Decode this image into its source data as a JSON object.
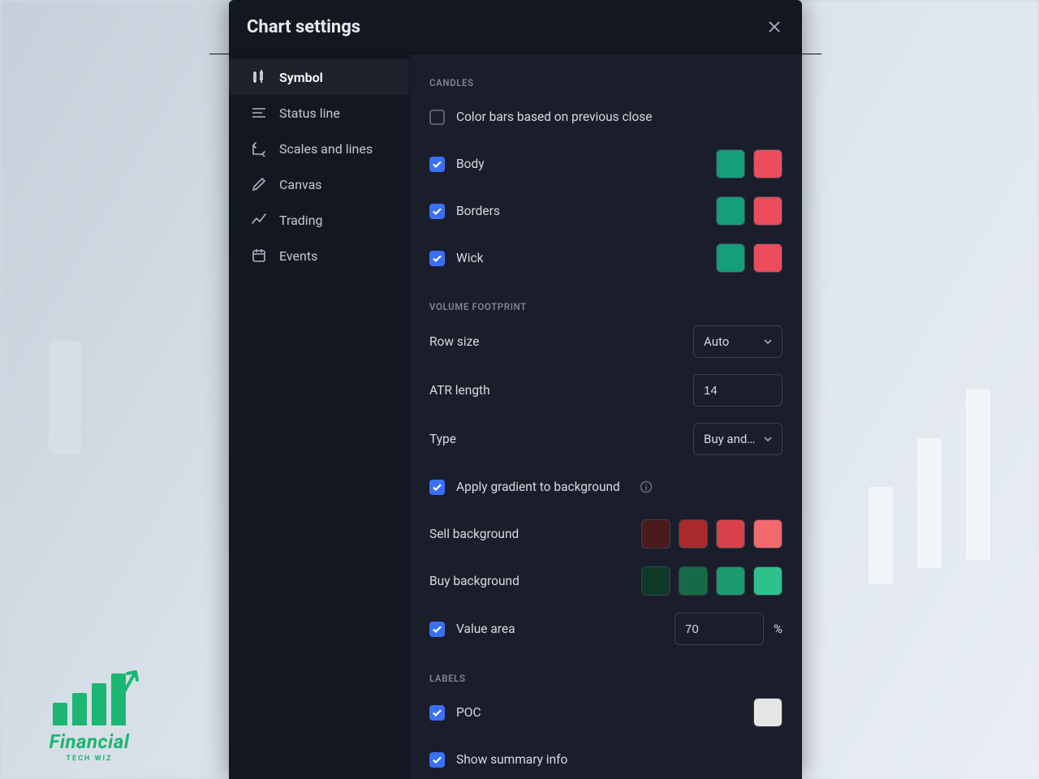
{
  "modal": {
    "title": "Chart settings"
  },
  "sidebar": {
    "items": [
      {
        "label": "Symbol",
        "active": true
      },
      {
        "label": "Status line",
        "active": false
      },
      {
        "label": "Scales and lines",
        "active": false
      },
      {
        "label": "Canvas",
        "active": false
      },
      {
        "label": "Trading",
        "active": false
      },
      {
        "label": "Events",
        "active": false
      }
    ]
  },
  "sections": {
    "candles": {
      "title": "CANDLES",
      "color_bars_prev_close": {
        "label": "Color bars based on previous close",
        "checked": false
      },
      "body": {
        "label": "Body",
        "checked": true,
        "color_up": "#159e7a",
        "color_down": "#eb4d5c"
      },
      "borders": {
        "label": "Borders",
        "checked": true,
        "color_up": "#159e7a",
        "color_down": "#eb4d5c"
      },
      "wick": {
        "label": "Wick",
        "checked": true,
        "color_up": "#159e7a",
        "color_down": "#eb4d5c"
      }
    },
    "volume_footprint": {
      "title": "VOLUME FOOTPRINT",
      "row_size": {
        "label": "Row size",
        "value": "Auto"
      },
      "atr_length": {
        "label": "ATR length",
        "value": "14"
      },
      "type": {
        "label": "Type",
        "value": "Buy and …"
      },
      "apply_gradient": {
        "label": "Apply gradient to background",
        "checked": true
      },
      "sell_bg": {
        "label": "Sell background",
        "colors": [
          "#4a1b1b",
          "#a82a2a",
          "#d84149",
          "#f26a6e"
        ]
      },
      "buy_bg": {
        "label": "Buy background",
        "colors": [
          "#0e3a27",
          "#176a48",
          "#1c9b6e",
          "#2cc18d"
        ]
      },
      "value_area": {
        "label": "Value area",
        "checked": true,
        "value": "70",
        "unit": "%"
      }
    },
    "labels": {
      "title": "LABELS",
      "poc": {
        "label": "POC",
        "checked": true,
        "color": "#e6e6e6"
      },
      "show_summary": {
        "label": "Show summary info",
        "checked": true
      }
    }
  },
  "logo": {
    "line1": "Financial",
    "line2": "TECH WIZ"
  }
}
